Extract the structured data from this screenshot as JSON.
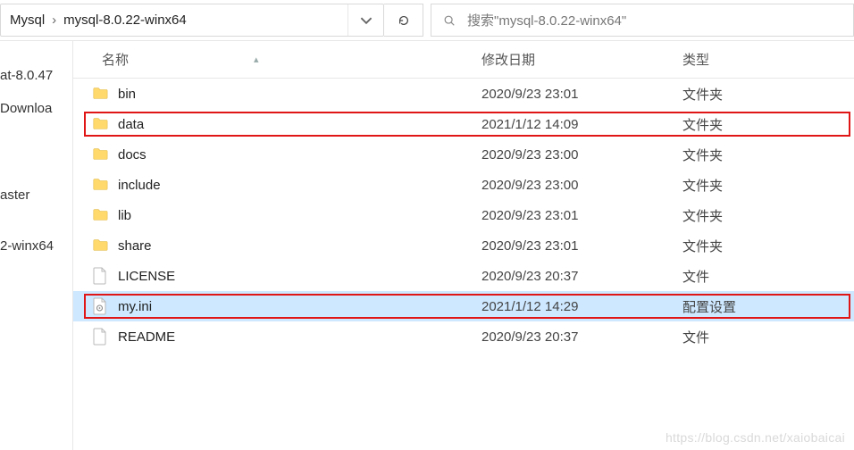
{
  "address": {
    "crumb1": "Mysql",
    "sep": "›",
    "crumb2": "mysql-8.0.22-winx64"
  },
  "search": {
    "placeholder": "搜索\"mysql-8.0.22-winx64\""
  },
  "sidebar": {
    "items": [
      {
        "label": "at-8.0.47"
      },
      {
        "label": "Downloa"
      },
      {
        "label": ""
      },
      {
        "label": ""
      },
      {
        "label": ""
      },
      {
        "label": "aster"
      },
      {
        "label": ""
      },
      {
        "label": "2-winx64"
      }
    ]
  },
  "columns": {
    "name": "名称",
    "date": "修改日期",
    "type": "类型"
  },
  "rows": [
    {
      "icon": "folder",
      "name": "bin",
      "date": "2020/9/23 23:01",
      "type": "文件夹",
      "sel": false
    },
    {
      "icon": "folder",
      "name": "data",
      "date": "2021/1/12 14:09",
      "type": "文件夹",
      "sel": false
    },
    {
      "icon": "folder",
      "name": "docs",
      "date": "2020/9/23 23:00",
      "type": "文件夹",
      "sel": false
    },
    {
      "icon": "folder",
      "name": "include",
      "date": "2020/9/23 23:00",
      "type": "文件夹",
      "sel": false
    },
    {
      "icon": "folder",
      "name": "lib",
      "date": "2020/9/23 23:01",
      "type": "文件夹",
      "sel": false
    },
    {
      "icon": "folder",
      "name": "share",
      "date": "2020/9/23 23:01",
      "type": "文件夹",
      "sel": false
    },
    {
      "icon": "file",
      "name": "LICENSE",
      "date": "2020/9/23 20:37",
      "type": "文件",
      "sel": false
    },
    {
      "icon": "ini",
      "name": "my.ini",
      "date": "2021/1/12 14:29",
      "type": "配置设置",
      "sel": true
    },
    {
      "icon": "file",
      "name": "README",
      "date": "2020/9/23 20:37",
      "type": "文件",
      "sel": false
    }
  ],
  "highlights": [
    {
      "row_index": 1
    },
    {
      "row_index": 7
    }
  ],
  "watermark": "https://blog.csdn.net/xaiobaicai"
}
